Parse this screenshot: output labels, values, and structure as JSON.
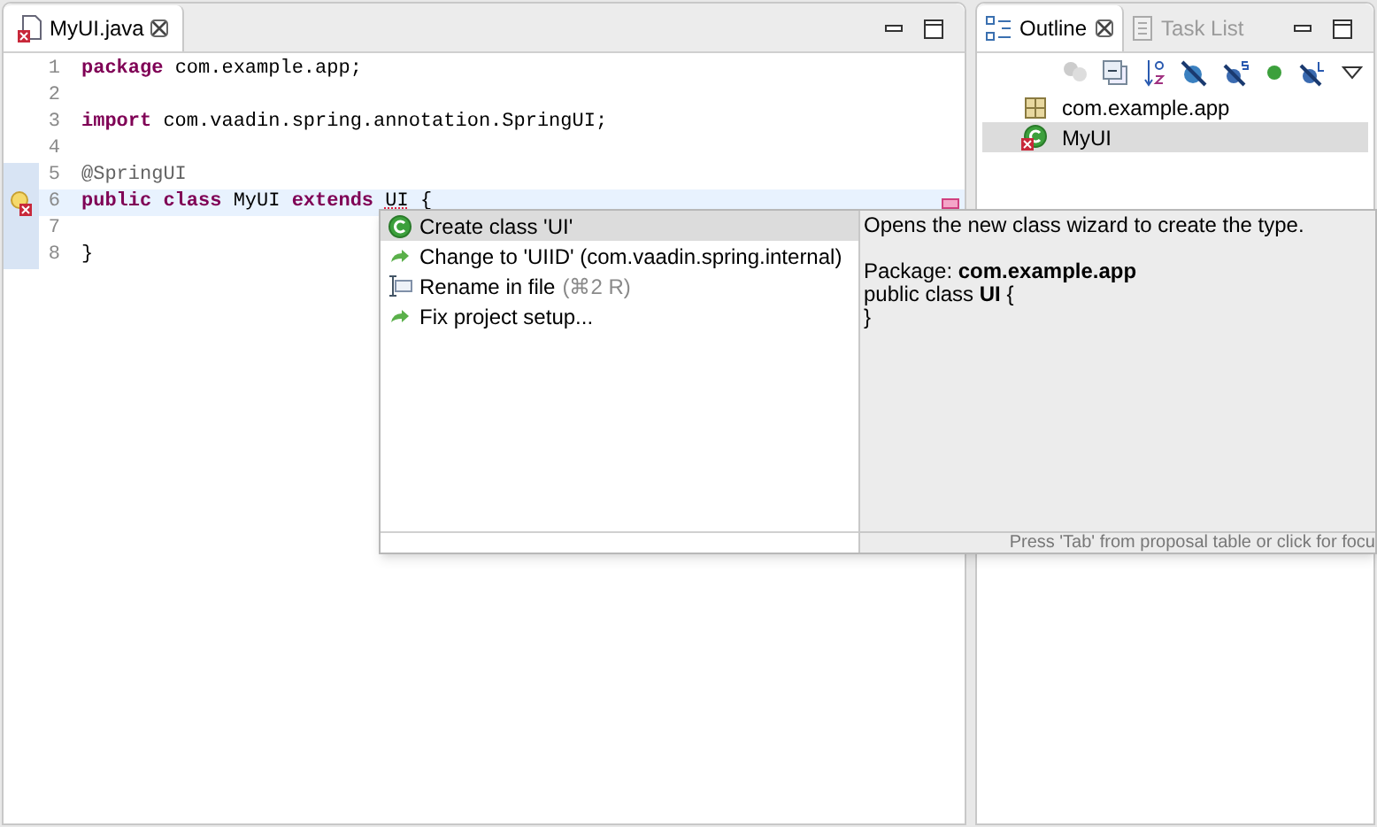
{
  "editor": {
    "tab": {
      "label": "MyUI.java",
      "selected": true
    },
    "lines": [
      {
        "number": "1",
        "current": false,
        "error": false,
        "changed": false,
        "tokens": [
          {
            "text": "package",
            "kind": "keyword"
          },
          {
            "text": " com.example.app;",
            "kind": "plain"
          }
        ]
      },
      {
        "number": "2",
        "current": false,
        "error": false,
        "changed": false
      },
      {
        "number": "3",
        "current": false,
        "error": false,
        "changed": false,
        "tokens": [
          {
            "text": "import",
            "kind": "keyword"
          },
          {
            "text": " com.vaadin.spring.annotation.SpringUI;",
            "kind": "plain"
          }
        ]
      },
      {
        "number": "4",
        "current": false,
        "error": false,
        "changed": false
      },
      {
        "number": "5",
        "current": false,
        "error": false,
        "changed": true,
        "tokens": [
          {
            "text": "@SpringUI",
            "kind": "annotation"
          }
        ]
      },
      {
        "number": "6",
        "current": true,
        "error": true,
        "changed": true,
        "tokens": [
          {
            "text": "public class",
            "kind": "keyword"
          },
          {
            "text": " MyUI ",
            "kind": "plain"
          },
          {
            "text": "extends ",
            "kind": "keyword"
          },
          {
            "text": "UI",
            "kind": "error"
          },
          {
            "text": " {",
            "kind": "plain"
          }
        ]
      },
      {
        "number": "7",
        "current": false,
        "error": false,
        "changed": true
      },
      {
        "number": "8",
        "current": false,
        "error": false,
        "changed": true,
        "tokens": [
          {
            "text": "}",
            "kind": "plain"
          }
        ]
      }
    ]
  },
  "quick_fix": {
    "proposals": [
      {
        "label": "Create class 'UI'",
        "kind": "create",
        "selected": true
      },
      {
        "label": "Change to 'UIID' (com.vaadin.spring.internal)",
        "kind": "change",
        "selected": false
      },
      {
        "label": "Rename in file",
        "shortcut": "(⌘2 R)",
        "kind": "rename",
        "selected": false
      },
      {
        "label": "Fix project setup...",
        "kind": "change",
        "selected": false
      }
    ],
    "description": "Opens the new class wizard to create the type.",
    "preview": [
      "Package: **com.example.app**",
      "public class **UI** {",
      "}"
    ],
    "footer": "Press 'Tab' from proposal table or click for focu"
  },
  "outline": {
    "tabs": [
      {
        "label": "Outline",
        "selected": true
      },
      {
        "label": "Task List",
        "selected": false
      }
    ],
    "items": [
      {
        "label": "com.example.app",
        "kind": "package",
        "selected": false
      },
      {
        "label": "MyUI",
        "kind": "class",
        "selected": true
      }
    ]
  }
}
